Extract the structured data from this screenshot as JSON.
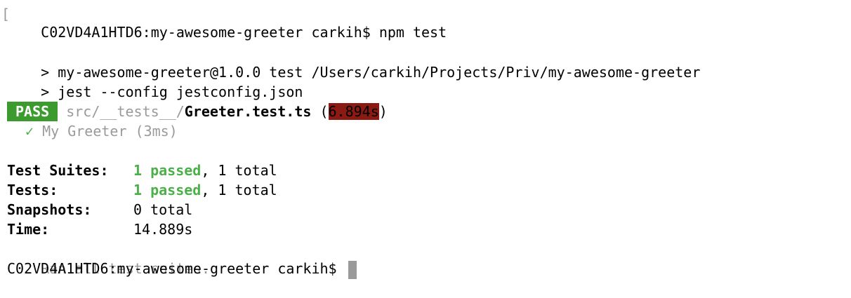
{
  "terminal": {
    "prompt1": "C02VD4A1HTD6:my-awesome-greeter carkih$ npm test",
    "script_line1": "> my-awesome-greeter@1.0.0 test /Users/carkih/Projects/Priv/my-awesome-greeter",
    "script_line2": "> jest --config jestconfig.json",
    "result": {
      "badge": "PASS",
      "path_dim": "src/__tests__/",
      "file": "Greeter.test.ts",
      "open_paren": " (",
      "duration": "6.894s",
      "close_paren": ")"
    },
    "test_case": {
      "check": "✓",
      "name": "My Greeter (3ms)"
    },
    "summary": {
      "suites_label": "Test Suites:",
      "suites_passed": "1 passed",
      "suites_total": ", 1 total",
      "tests_label": "Tests:",
      "tests_passed": "1 passed",
      "tests_total": ", 1 total",
      "snapshots_label": "Snapshots:",
      "snapshots_value": "0 total",
      "time_label": "Time:",
      "time_value": "14.889s",
      "ran_all": "Ran all test suites."
    },
    "prompt2": "C02VD4A1HTD6:my-awesome-greeter carkih$ "
  }
}
